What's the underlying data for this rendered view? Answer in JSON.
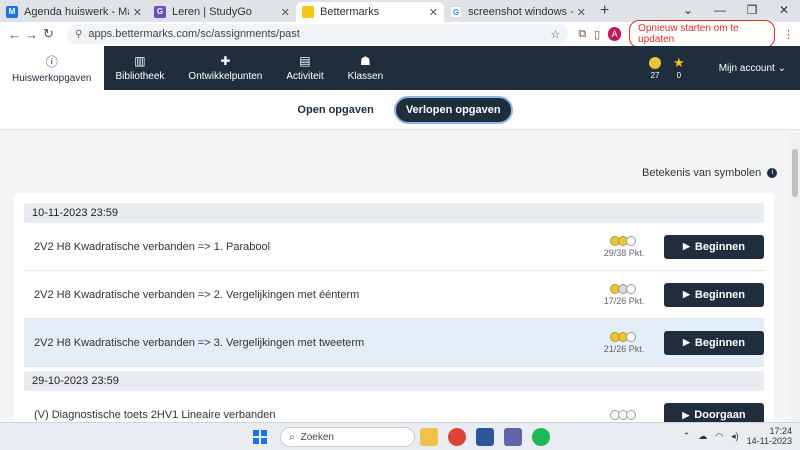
{
  "browser": {
    "tabs": [
      {
        "label": "Agenda huiswerk - Magister",
        "favicon_letter": "M",
        "favicon_color": "#1a73e8"
      },
      {
        "label": "Leren | StudyGo",
        "favicon_letter": "G",
        "favicon_color": "#6a4fc4"
      },
      {
        "label": "Bettermarks",
        "favicon_letter": "",
        "favicon_color": "#f5c518",
        "active": true
      },
      {
        "label": "screenshot windows - Google Z",
        "favicon_letter": "G",
        "favicon_color": "#ffffff"
      }
    ],
    "url": "apps.bettermarks.com/sc/assignments/past",
    "profile_letter": "A",
    "update_button": "Opnieuw starten om te updaten"
  },
  "appnav": {
    "items": [
      {
        "label": "Huiswerkopgaven",
        "icon": "info-icon",
        "active": true
      },
      {
        "label": "Bibliotheek",
        "icon": "library-icon"
      },
      {
        "label": "Ontwikkelpunten",
        "icon": "puzzle-icon"
      },
      {
        "label": "Activiteit",
        "icon": "document-icon"
      },
      {
        "label": "Klassen",
        "icon": "people-icon"
      }
    ],
    "coins": "27",
    "stars": "0",
    "account": "Mijn account"
  },
  "subnav": {
    "open": "Open opgaven",
    "past": "Verlopen opgaven"
  },
  "legend_link": "Betekenis van symbolen",
  "groups": [
    {
      "date": "10-11-2023 23:59",
      "assignments": [
        {
          "title": "2V2 H8 Kwadratische verbanden => 1. Parabool",
          "points": "29/38 Pkt.",
          "button": "Beginnen",
          "coins": [
            "gold",
            "gold",
            "empty"
          ]
        },
        {
          "title": "2V2 H8 Kwadratische verbanden => 2. Vergelijkingen met éénterm",
          "points": "17/26 Pkt.",
          "button": "Beginnen",
          "coins": [
            "gold",
            "silver",
            "empty"
          ]
        },
        {
          "title": "2V2 H8 Kwadratische verbanden => 3. Vergelijkingen met tweeterm",
          "points": "21/26 Pkt.",
          "button": "Beginnen",
          "coins": [
            "gold",
            "gold",
            "empty"
          ],
          "highlighted": true
        }
      ]
    },
    {
      "date": "29-10-2023 23:59",
      "assignments": [
        {
          "title": "(V) Diagnostische toets 2HV1 Lineaire verbanden",
          "points": "",
          "button": "Doorgaan",
          "coins": [
            "empty",
            "empty",
            "empty"
          ]
        }
      ]
    }
  ],
  "taskbar": {
    "search": "Zoeken",
    "time": "17:24",
    "date": "14-11-2023"
  }
}
